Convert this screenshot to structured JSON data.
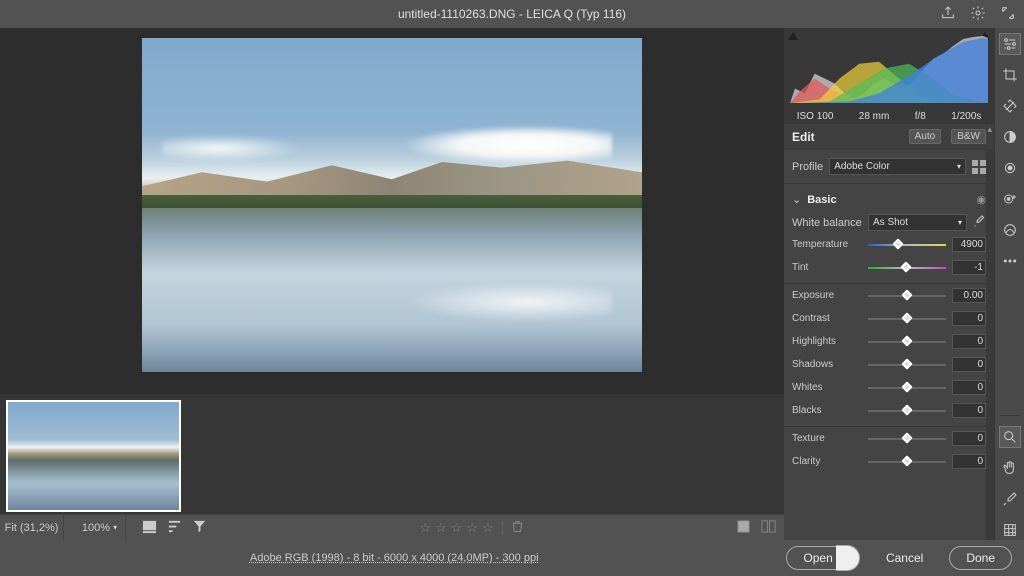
{
  "header": {
    "title": "untitled-1110263.DNG  -  LEICA Q (Typ 116)"
  },
  "exif": {
    "iso": "ISO 100",
    "focal": "28 mm",
    "aperture": "f/8",
    "shutter": "1/200s"
  },
  "panel": {
    "edit_label": "Edit",
    "auto_label": "Auto",
    "bw_label": "B&W",
    "profile_label": "Profile",
    "profile_value": "Adobe Color",
    "basic_label": "Basic",
    "wb_label": "White balance",
    "wb_value": "As Shot",
    "sliders": {
      "temperature": {
        "label": "Temperature",
        "value": "4900",
        "pos": 38
      },
      "tint": {
        "label": "Tint",
        "value": "-1",
        "pos": 49
      },
      "exposure": {
        "label": "Exposure",
        "value": "0.00",
        "pos": 50
      },
      "contrast": {
        "label": "Contrast",
        "value": "0",
        "pos": 50
      },
      "highlights": {
        "label": "Highlights",
        "value": "0",
        "pos": 50
      },
      "shadows": {
        "label": "Shadows",
        "value": "0",
        "pos": 50
      },
      "whites": {
        "label": "Whites",
        "value": "0",
        "pos": 50
      },
      "blacks": {
        "label": "Blacks",
        "value": "0",
        "pos": 50
      },
      "texture": {
        "label": "Texture",
        "value": "0",
        "pos": 50
      },
      "clarity": {
        "label": "Clarity",
        "value": "0",
        "pos": 50
      }
    }
  },
  "statusbar": {
    "fit": "Fit (31,2%)",
    "zoom": "100%"
  },
  "footer": {
    "fileinfo": "Adobe RGB (1998) - 8 bit - 6000 x 4000 (24,0MP) - 300 ppi",
    "open": "Open",
    "cancel": "Cancel",
    "done": "Done"
  }
}
